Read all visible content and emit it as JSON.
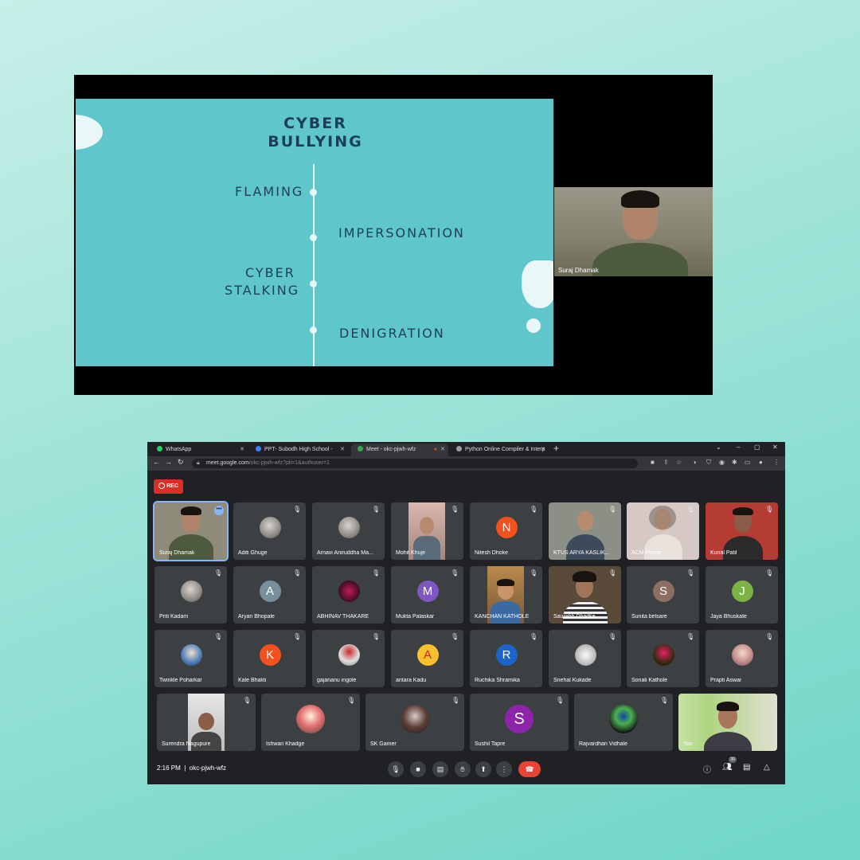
{
  "slide": {
    "title_line1": "CYBER",
    "title_line2": "BULLYING",
    "terms": [
      "FLAMING",
      "IMPERSONATION",
      "CYBER",
      "STALKING",
      "DENIGRATION"
    ]
  },
  "presenter": {
    "name": "Suraj Dhamak"
  },
  "browser": {
    "tabs": [
      {
        "label": "WhatsApp",
        "color": "#25d366"
      },
      {
        "label": "PPT- Subodh High School - Prese",
        "color": "#3b82f6"
      },
      {
        "label": "Meet - okc-pjwh-wfz",
        "color": "#34a853"
      },
      {
        "label": "Python Online Compiler & Interp",
        "color": "#9e9e9e"
      }
    ],
    "url_host": "meet.google.com",
    "url_path": "/okc-pjwh-wfz?pli=1&authuser=1"
  },
  "meet": {
    "rec_label": "REC",
    "time": "2:16 PM",
    "meeting_code": "okc-pjwh-wfz",
    "participant_count": "30",
    "participants_row1": [
      "Suraj Dhamak",
      "Aditi Ghuge",
      "Arnavi Aniruddha Ma...",
      "Mohit Khuje",
      "Nitesh Dhoke",
      "KTUS ARYA KASLIK...",
      "ACM Pocoe",
      "Kunal Patil"
    ],
    "participants_row2": [
      "Priti Kadam",
      "Aryan Bhopale",
      "ABHINAV THAKARE",
      "Mukta Palaskar",
      "KANCHAN KATHOLE",
      "Saurabh Dhadke",
      "Sunita belsare",
      "Jaya Bhuskate"
    ],
    "participants_row3": [
      "Twinkle Poharkar",
      "Kale Bhakti",
      "gajananu ingole",
      "antara Kadu",
      "Ruchika Shramika",
      "Snehal Kukade",
      "Sonali Kathole",
      "Prapti Aswar"
    ],
    "participants_row4": [
      "Surendra Nagupure",
      "Ishwari Khadge",
      "SK Gamer",
      "Sushil Tapre",
      "Rajvardhan Vidhale",
      "You"
    ],
    "initials": {
      "nitesh": "N",
      "aryan": "A",
      "mukta": "M",
      "sunita": "S",
      "jaya": "J",
      "kale": "K",
      "antara": "A",
      "ruchika": "R",
      "sushil": "S"
    },
    "colors": {
      "nitesh": "#f4511e",
      "aryan": "#78909c",
      "mukta": "#7e57c2",
      "sunita": "#8d6e63",
      "jaya": "#7cb342",
      "kale": "#f4511e",
      "antara": "#fbc02d",
      "ruchika": "#1e63c8",
      "sushil": "#8e24aa"
    }
  }
}
